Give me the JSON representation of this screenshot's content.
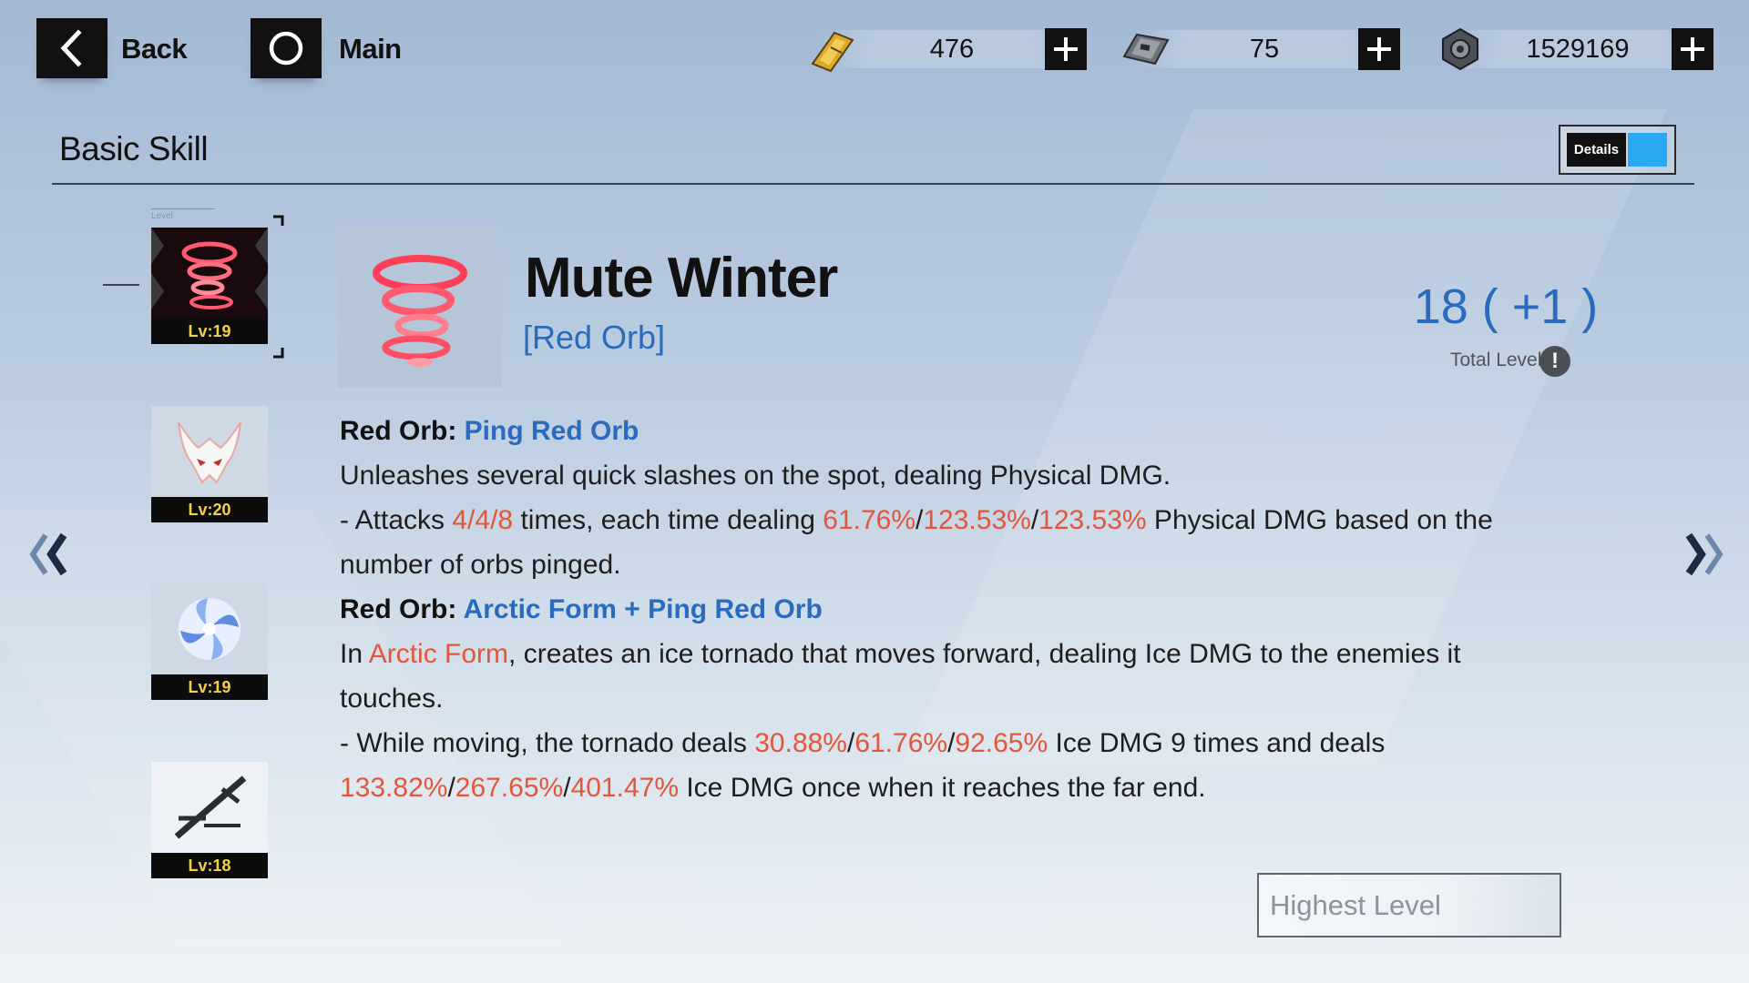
{
  "top_bar": {
    "back_label": "Back",
    "main_label": "Main",
    "resources": [
      {
        "icon": "gold-ticket-icon",
        "value": "476"
      },
      {
        "icon": "card-chip-icon",
        "value": "75"
      },
      {
        "icon": "hex-nut-coin-icon",
        "value": "1529169"
      }
    ]
  },
  "section": {
    "title": "Basic Skill",
    "details_label": "Details",
    "details_on": true
  },
  "skill_list": {
    "header": "Level",
    "items": [
      {
        "icon": "red-tornado-icon",
        "level": "Lv:19",
        "selected": true
      },
      {
        "icon": "horned-mask-icon",
        "level": "Lv:20",
        "selected": false
      },
      {
        "icon": "ice-swirl-icon",
        "level": "Lv:19",
        "selected": false
      },
      {
        "icon": "sword-icon",
        "level": "Lv:18",
        "selected": false
      }
    ]
  },
  "skill": {
    "name": "Mute Winter",
    "tag": "[Red Orb]",
    "total_level": "18 ( +1 )",
    "total_level_label": "Total Level"
  },
  "description": [
    {
      "type": "heading",
      "parts": [
        {
          "t": "Red Orb: ",
          "c": "plain"
        },
        {
          "t": "Ping Red Orb",
          "c": "blue"
        }
      ]
    },
    {
      "type": "line",
      "parts": [
        {
          "t": "Unleashes several quick slashes on the spot, dealing Physical DMG.",
          "c": "plain"
        }
      ]
    },
    {
      "type": "line",
      "parts": [
        {
          "t": "- Attacks ",
          "c": "plain"
        },
        {
          "t": "4/4/8",
          "c": "red"
        },
        {
          "t": " times, each time dealing ",
          "c": "plain"
        },
        {
          "t": "61.76%",
          "c": "red"
        },
        {
          "t": "/",
          "c": "plain"
        },
        {
          "t": "123.53%",
          "c": "red"
        },
        {
          "t": "/",
          "c": "plain"
        },
        {
          "t": "123.53%",
          "c": "red"
        },
        {
          "t": " Physical DMG based on the number of orbs pinged.",
          "c": "plain"
        }
      ]
    },
    {
      "type": "heading",
      "parts": [
        {
          "t": "Red Orb: ",
          "c": "plain"
        },
        {
          "t": "Arctic Form + Ping Red Orb",
          "c": "blue"
        }
      ]
    },
    {
      "type": "line",
      "parts": [
        {
          "t": "In ",
          "c": "plain"
        },
        {
          "t": "Arctic Form",
          "c": "red"
        },
        {
          "t": ", creates an ice tornado that moves forward, dealing Ice DMG to the enemies it touches.",
          "c": "plain"
        }
      ]
    },
    {
      "type": "line",
      "parts": [
        {
          "t": "- While moving, the tornado deals ",
          "c": "plain"
        },
        {
          "t": "30.88%",
          "c": "red"
        },
        {
          "t": "/",
          "c": "plain"
        },
        {
          "t": "61.76%",
          "c": "red"
        },
        {
          "t": "/",
          "c": "plain"
        },
        {
          "t": "92.65%",
          "c": "red"
        },
        {
          "t": " Ice DMG 9 times and deals ",
          "c": "plain"
        },
        {
          "t": "133.82%",
          "c": "red"
        },
        {
          "t": "/",
          "c": "plain"
        },
        {
          "t": "267.65%",
          "c": "red"
        },
        {
          "t": "/",
          "c": "plain"
        },
        {
          "t": "401.47%",
          "c": "red"
        },
        {
          "t": " Ice DMG once when it reaches the far end.",
          "c": "plain"
        }
      ]
    }
  ],
  "footer": {
    "highest_level_label": "Highest Level"
  },
  "colors": {
    "accent_blue": "#2a6bbd",
    "value_red": "#e2573a",
    "toggle_blue": "#2aa8f2",
    "level_yellow": "#f2d14a"
  }
}
